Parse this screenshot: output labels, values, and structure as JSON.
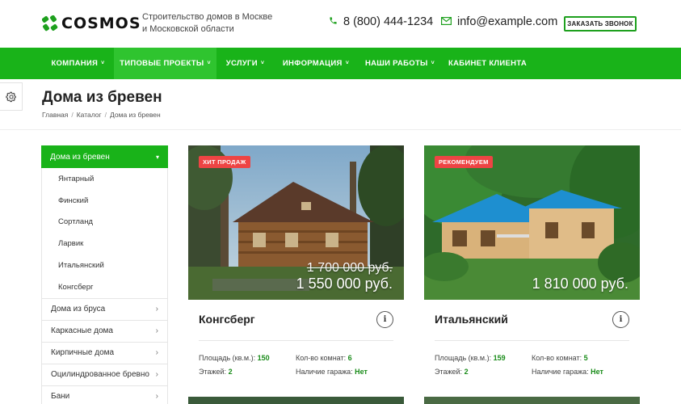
{
  "header": {
    "logo": "COSMOS",
    "tagline": "Строительство домов в Москве и Московской области",
    "phone": "8 (800) 444-1234",
    "email": "info@example.com",
    "callback_label": "ЗАКАЗАТЬ ЗВОНОК",
    "brand_color": "#19b319"
  },
  "nav": {
    "items": [
      {
        "label": "КОМПАНИЯ",
        "has_dropdown": true
      },
      {
        "label": "ТИПОВЫЕ ПРОЕКТЫ",
        "has_dropdown": true,
        "active": true
      },
      {
        "label": "УСЛУГИ",
        "has_dropdown": true
      },
      {
        "label": "ИНФОРМАЦИЯ",
        "has_dropdown": true
      },
      {
        "label": "НАШИ РАБОТЫ",
        "has_dropdown": true
      },
      {
        "label": "КАБИНЕТ КЛИЕНТА",
        "has_dropdown": false
      }
    ]
  },
  "page": {
    "title": "Дома из бревен",
    "breadcrumb": [
      "Главная",
      "Каталог",
      "Дома из бревен"
    ]
  },
  "sidebar": {
    "active": "Дома из бревен",
    "subitems": [
      "Янтарный",
      "Финский",
      "Сортланд",
      "Ларвик",
      "Итальянский",
      "Конгсберг"
    ],
    "items": [
      "Дома из бруса",
      "Каркасные дома",
      "Кирпичные дома",
      "Оцилиндрованное бревно",
      "Бани"
    ]
  },
  "cards": [
    {
      "badge": "ХИТ ПРОДАЖ",
      "price_old": "1 700 000 руб.",
      "price_new": "1 550 000 руб.",
      "title": "Конгсберг",
      "area_label": "Площадь (кв.м.):",
      "area": "150",
      "rooms_label": "Кол-во комнат:",
      "rooms": "6",
      "floors_label": "Этажей:",
      "floors": "2",
      "garage_label": "Наличие гаража:",
      "garage": "Нет"
    },
    {
      "badge": "РЕКОМЕНДУЕМ",
      "price_old": "",
      "price_new": "1 810 000 руб.",
      "title": "Итальянский",
      "area_label": "Площадь (кв.м.):",
      "area": "159",
      "rooms_label": "Кол-во комнат:",
      "rooms": "5",
      "floors_label": "Этажей:",
      "floors": "2",
      "garage_label": "Наличие гаража:",
      "garage": "Нет"
    }
  ]
}
